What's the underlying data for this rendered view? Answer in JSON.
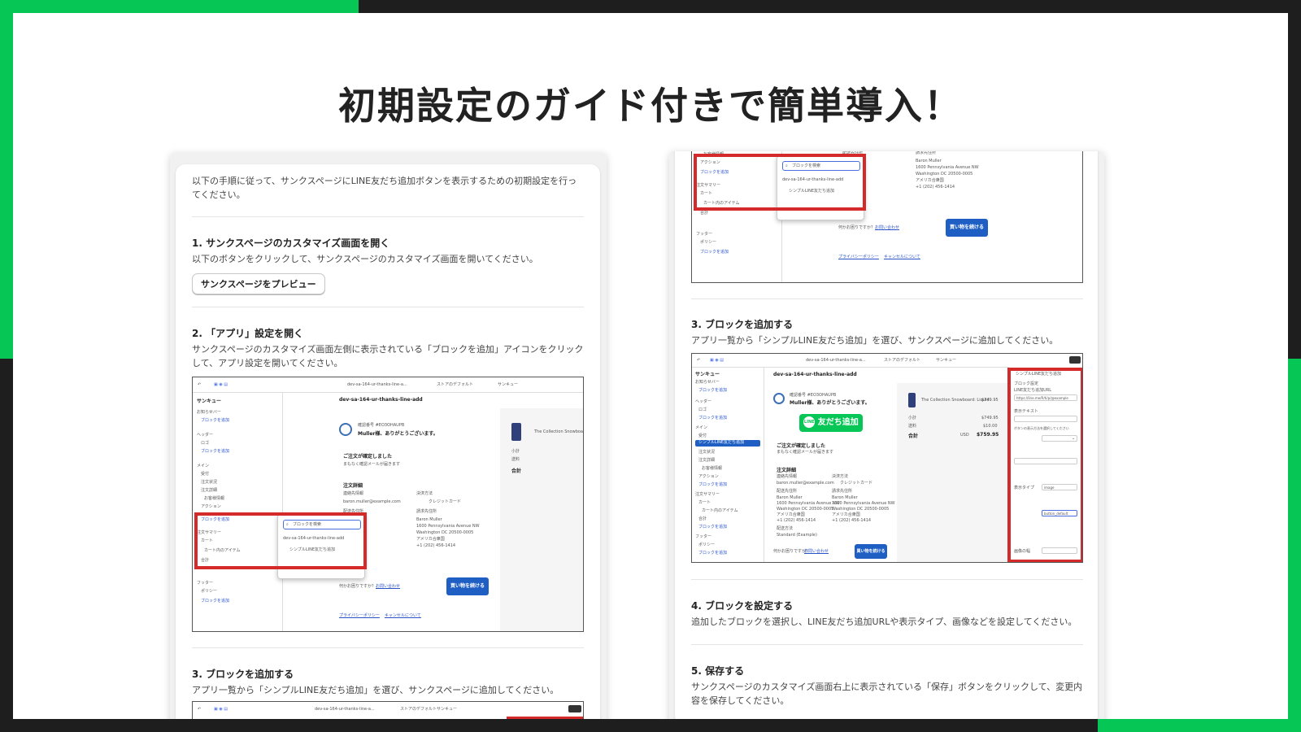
{
  "headline": "初期設定のガイド付きで簡単導入！",
  "left": {
    "intro": "以下の手順に従って、サンクスページにLINE友だち追加ボタンを表示するための初期設定を行ってください。",
    "step1_title": "1. サンクスページのカスタマイズ画面を開く",
    "step1_desc": "以下のボタンをクリックして、サンクスページのカスタマイズ画面を開いてください。",
    "preview_button": "サンクスページをプレビュー",
    "step2_title": "2. 「アプリ」設定を開く",
    "step2_desc": "サンクスページのカスタマイズ画面左側に表示されている「ブロックを追加」アイコンをクリックして、アプリ設定を開いてください。",
    "step3_title": "3. ブロックを追加する",
    "step3_desc": "アプリ一覧から「シンプルLINE友だち追加」を選び、サンクスページに追加してください。"
  },
  "right": {
    "step3_title": "3. ブロックを追加する",
    "step3_desc": "アプリ一覧から「シンプルLINE友だち追加」を選び、サンクスページに追加してください。",
    "step4_title": "4. ブロックを設定する",
    "step4_desc": "追加したブロックを選択し、LINE友だち追加URLや表示タイプ、画像などを設定してください。",
    "step5_title": "5. 保存する",
    "step5_desc": "サンクスページのカスタマイズ画面右上に表示されている「保存」ボタンをクリックして、変更内容を保存してください。"
  },
  "editor": {
    "store_name": "dev-sa-164-ur-thanks-line-add",
    "store_short": "dev-sa-164-ur-thanks-line-a...",
    "theme_label": "ストアのデフォルト",
    "page_label": "サンキュー",
    "sidebar_title": "サンキュー",
    "sec_announce": "お知らせバー",
    "add_block": "ブロックを追加",
    "sec_header": "ヘッダー",
    "logo": "ロゴ",
    "sec_main": "メイン",
    "item_thanks": "受付",
    "item_status": "注文状況",
    "item_details": "注文詳細",
    "item_contact": "お客様情報",
    "item_action": "アクション",
    "sec_summary": "注文サマリー",
    "item_cart": "カート",
    "item_cart_items": "カート内のアイテム",
    "item_total": "合計",
    "sec_footer": "フッター",
    "item_policy": "ポリシー",
    "order_no": "確認番号 #EO3OHAUPB",
    "thanks_msg": "Muller様、ありがとうございます。",
    "confirmed": "ご注文が確定しました",
    "confirm_mail": "まもなく確認メールが届きます",
    "order_details": "注文詳細",
    "contact_info": "連絡先情報",
    "email": "baron.muller@example.com",
    "shipping_addr": "配送先住所",
    "payment": "決済方法",
    "card": "クレジットカード",
    "billing_addr": "請求先住所",
    "name": "Baron Muller",
    "addr1": "1600 Pennsylvania Avenue NW",
    "addr2": "Washington DC 20500-0005",
    "country": "アメリカ合衆国",
    "phone": "+1 (202) 456-1414",
    "shipping_method": "配送方法",
    "shipping_std": "Standard (Example)",
    "help": "何かお困りですか？",
    "contact_link": "お問い合わせ",
    "continue": "買い物を続ける",
    "privacy": "プライバシーポリシー",
    "cancel_policy": "キャンセルについて",
    "search_ph": "ブロックを検索",
    "app_name": "シンプルLINE友だち追加",
    "product": "The Collection Snowboard: Liquid",
    "subtotal": "小計",
    "shipping": "送料",
    "total": "合計",
    "price": "$749.95",
    "ship_price": "$10.00",
    "currency": "USD",
    "total_price": "$759.95",
    "line_btn": "友だち追加",
    "line_logo": "LINE",
    "settings_title": "シンプルLINE友だち追加",
    "block_settings": "ブロック設定",
    "url_label": "LINE友だち追加URL",
    "url_value": "https://line.me/R/ti/p/@example",
    "display_text": "表示テキスト",
    "display_type": "表示タイプ",
    "image_type": "image",
    "button_image": "button_default",
    "label_image": "画像の幅",
    "label_desc": "ボタンの表示方法を選択してください",
    "save": "保存"
  },
  "colors": {
    "line_green": "#06c755",
    "highlight_red": "#d42a2a",
    "primary_blue": "#1f5fc4"
  }
}
